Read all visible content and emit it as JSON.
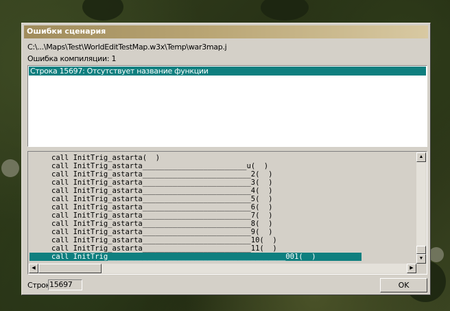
{
  "dialog": {
    "title": "Ошибки сценария",
    "file_path": "C:\\...\\Maps\\Test\\WorldEditTestMap.w3x\\Temp\\war3map.j",
    "compile_errors": "Ошибка компиляции: 1",
    "errors": [
      "Строка 15697: Отсутствует название функции"
    ],
    "code_lines": [
      "call InitTrig_astarta(  )",
      "call InitTrig_astarta________________________u(  )",
      "call InitTrig_astarta_________________________2(  )",
      "call InitTrig_astarta_________________________3(  )",
      "call InitTrig_astarta_________________________4(  )",
      "call InitTrig_astarta_________________________5(  )",
      "call InitTrig_astarta_________________________6(  )",
      "call InitTrig_astarta_________________________7(  )",
      "call InitTrig_astarta_________________________8(  )",
      "call InitTrig_astarta_________________________9(  )",
      "call InitTrig_astarta_________________________10(  )",
      "call InitTrig_astarta_________________________11(  )",
      "call InitTrig_________________________________________001(  )"
    ],
    "highlighted_line_index": 12,
    "line_label": "Строк",
    "line_value": "15697",
    "ok_label": "OK",
    "scroll_up_icon": "up-arrow-icon",
    "scroll_down_icon": "down-arrow-icon",
    "scroll_left_icon": "left-arrow-icon",
    "scroll_right_icon": "right-arrow-icon"
  }
}
